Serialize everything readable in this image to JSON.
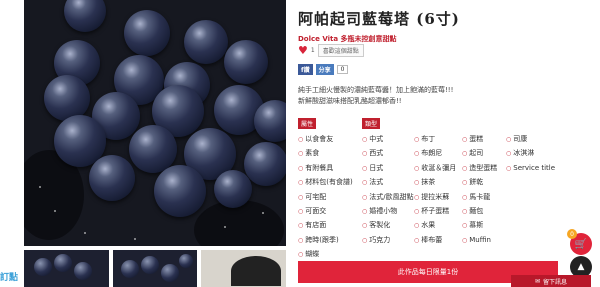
{
  "product": {
    "title": "阿帕起司藍莓塔 (6寸)",
    "shop_name": "Dolce Vita 多瓶未控創意甜點",
    "like_count": "1",
    "tag_button": "喜歡這個甜點",
    "description_line1": "純手工細火慢製的濃純藍莓醬！加上飽滿的藍莓!!!",
    "description_line2": "新鮮酸甜滋味搭配乳酪超濃郁香!!"
  },
  "share": {
    "facebook_label": "f讚",
    "plurk_label": "分享",
    "count": "0"
  },
  "filters": {
    "label_a": "屬性",
    "label_b": "類型",
    "tags": [
      "以食會友",
      "中式",
      "布丁",
      "蛋糕",
      "司康",
      "素食",
      "西式",
      "布朗尼",
      "起司",
      "冰淇淋",
      "有附餐具",
      "日式",
      "收涎＆彌月",
      "造型蛋糕",
      "Service title",
      "材料包(有食譜)",
      "法式",
      "抹茶",
      "餅乾",
      "",
      "可宅配",
      "法式/歐風甜點",
      "提拉米蘇",
      "馬卡龍",
      "",
      "可面交",
      "婚禮小物",
      "杯子蛋糕",
      "麵包",
      "",
      "有店面",
      "客製化",
      "水果",
      "慕斯",
      "",
      "跨時(跟季)",
      "巧克力",
      "棒布蕾",
      "Muffin",
      "",
      "蝴蝶",
      "",
      "",
      "",
      ""
    ]
  },
  "purchase": {
    "limit_text": "此作品每日限量1份"
  },
  "widgets": {
    "cart_count": "0",
    "message_label": "留下訊息",
    "logo_text": "訂點"
  },
  "colors": {
    "accent": "#e0243a",
    "brand_red": "#c0202e"
  }
}
